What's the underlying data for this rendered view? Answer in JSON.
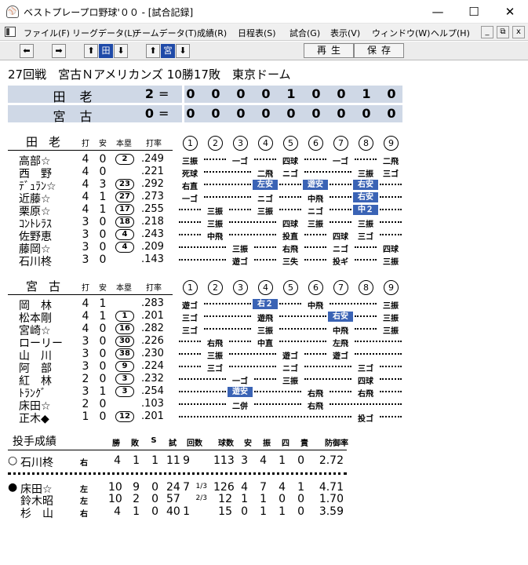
{
  "window": {
    "title": "ベストプレープロ野球'００ - [試合記録]",
    "minimize": "—",
    "maximize": "☐",
    "close": "✕",
    "app_icon": "baseball-cap-icon"
  },
  "menu": [
    "ファイル(F)",
    "リーグデータ(L)",
    "チームデータ(T)",
    "成績(R)",
    "日程表(S)",
    "試合(G)",
    "表示(V)",
    "ウィンドウ(W)",
    "ヘルプ(H)"
  ],
  "mdi": {
    "min": "_",
    "restore": "⧉",
    "close": "x"
  },
  "toolbar": {
    "prev": "⬅",
    "next": "➡",
    "up1": "⬆",
    "team1": "田",
    "down1": "⬇",
    "up2": "⬆",
    "team2": "宮",
    "down2": "⬇",
    "play": "再生",
    "save": "保存"
  },
  "game": {
    "title": "27回戦　宮古Ｎアメリカンズ 10勝17敗　東京ドーム"
  },
  "scoreboard": [
    {
      "team": "田老",
      "total": "2",
      "eq": "=",
      "innings": [
        "0",
        "0",
        "0",
        "0",
        "1",
        "0",
        "0",
        "1",
        "0"
      ]
    },
    {
      "team": "宮古",
      "total": "0",
      "eq": "=",
      "innings": [
        "0",
        "0",
        "0",
        "0",
        "0",
        "0",
        "0",
        "0",
        "0"
      ]
    }
  ],
  "columns": {
    "ab": "打",
    "hit": "安",
    "hr": "本塁",
    "avg": "打率",
    "innings": [
      "1",
      "2",
      "3",
      "4",
      "5",
      "6",
      "7",
      "8",
      "9"
    ]
  },
  "batting": [
    {
      "team": "田老",
      "players": [
        {
          "name": "高部☆",
          "ab": "4",
          "h": "0",
          "hr": "2",
          "avg": ".249",
          "res": {
            "1": "三振",
            "3": "一ゴ",
            "5": "四球",
            "7": "一ゴ",
            "9": "二飛"
          }
        },
        {
          "name": "西　野",
          "ab": "4",
          "h": "0",
          "hr": "",
          "avg": ".221",
          "res": {
            "1": "死球",
            "4": "二飛",
            "5": "ニゴ",
            "8": "三振",
            "9": "三ゴ"
          }
        },
        {
          "name": "ﾃﾞｭﾗﾝ☆",
          "ab": "4",
          "h": "3",
          "hr": "23",
          "avg": ".292",
          "res": {
            "1": "右直",
            "4": "左安",
            "6": "遊安",
            "8": "右安"
          },
          "hl": [
            "4",
            "6",
            "8"
          ]
        },
        {
          "name": "近藤☆",
          "ab": "4",
          "h": "1",
          "hr": "27",
          "avg": ".273",
          "res": {
            "1": "一ゴ",
            "4": "ニゴ",
            "6": "中飛",
            "8": "右安"
          },
          "hl": [
            "8"
          ]
        },
        {
          "name": "栗原☆",
          "ab": "4",
          "h": "1",
          "hr": "17",
          "avg": ".255",
          "res": {
            "2": "三振",
            "4": "三振",
            "6": "ニゴ",
            "8": "中２"
          },
          "hl": [
            "8"
          ]
        },
        {
          "name": "ｺﾝﾄﾚﾗｽ",
          "ab": "3",
          "h": "0",
          "hr": "18",
          "avg": ".218",
          "res": {
            "2": "三振",
            "5": "四球",
            "6": "三振",
            "8": "三振"
          }
        },
        {
          "name": "佐野恵",
          "ab": "3",
          "h": "0",
          "hr": "4",
          "avg": ".243",
          "res": {
            "2": "中飛",
            "5": "投直",
            "7": "四球",
            "8": "三ゴ"
          }
        },
        {
          "name": "藤岡☆",
          "ab": "3",
          "h": "0",
          "hr": "4",
          "avg": ".209",
          "res": {
            "3": "三振",
            "5": "右飛",
            "7": "ニゴ",
            "9": "四球"
          }
        },
        {
          "name": "石川柊",
          "ab": "3",
          "h": "0",
          "hr": "",
          "avg": ".143",
          "res": {
            "3": "遊ゴ",
            "5": "三失",
            "7": "投ギ",
            "9": "三振"
          }
        }
      ]
    },
    {
      "team": "宮古",
      "players": [
        {
          "name": "岡　林",
          "ab": "4",
          "h": "1",
          "hr": "",
          "avg": ".283",
          "res": {
            "1": "遊ゴ",
            "4": "右２",
            "6": "中飛",
            "9": "三振"
          },
          "hl": [
            "4"
          ]
        },
        {
          "name": "松本剛",
          "ab": "4",
          "h": "1",
          "hr": "1",
          "avg": ".201",
          "res": {
            "1": "三ゴ",
            "4": "遊飛",
            "7": "右安",
            "9": "三振"
          },
          "hl": [
            "7"
          ]
        },
        {
          "name": "宮崎☆",
          "ab": "4",
          "h": "0",
          "hr": "16",
          "avg": ".282",
          "res": {
            "1": "三ゴ",
            "4": "三振",
            "7": "中飛",
            "9": "三振"
          }
        },
        {
          "name": "ローリー",
          "ab": "3",
          "h": "0",
          "hr": "30",
          "avg": ".226",
          "res": {
            "2": "右飛",
            "4": "中直",
            "7": "左飛"
          }
        },
        {
          "name": "山　川",
          "ab": "3",
          "h": "0",
          "hr": "38",
          "avg": ".230",
          "res": {
            "2": "三振",
            "5": "遊ゴ",
            "7": "遊ゴ"
          }
        },
        {
          "name": "阿　部",
          "ab": "3",
          "h": "0",
          "hr": "9",
          "avg": ".224",
          "res": {
            "2": "三ゴ",
            "5": "ニゴ",
            "8": "三ゴ"
          }
        },
        {
          "name": "紅　林",
          "ab": "2",
          "h": "0",
          "hr": "3",
          "avg": ".232",
          "res": {
            "3": "一ゴ",
            "5": "三振",
            "8": "四球"
          }
        },
        {
          "name": "ﾄﾗﾝｸﾞ",
          "ab": "3",
          "h": "1",
          "hr": "3",
          "avg": ".254",
          "res": {
            "3": "遊安",
            "6": "右飛",
            "8": "右飛"
          },
          "hl": [
            "3"
          ]
        },
        {
          "name": "床田☆",
          "ab": "2",
          "h": "0",
          "hr": "",
          "avg": ".103",
          "res": {
            "3": "二併",
            "6": "右飛"
          }
        },
        {
          "name": "正木◆",
          "ab": "1",
          "h": "0",
          "hr": "12",
          "avg": ".201",
          "res": {
            "8": "投ゴ"
          }
        }
      ]
    }
  ],
  "pitching": {
    "title": "投手成績",
    "cols": [
      "勝",
      "敗",
      "S",
      "試",
      "回数",
      "球数",
      "安",
      "振",
      "四",
      "責",
      "防御率"
    ],
    "rows": [
      {
        "mark": "○",
        "name": "石川柊",
        "hand": "右",
        "w": "4",
        "l": "1",
        "s": "1",
        "g": "11",
        "ip": "9",
        "frac": "",
        "np": "113",
        "h": "3",
        "k": "4",
        "bb": "1",
        "er": "0",
        "era": "2.72"
      },
      {
        "mark": "●",
        "name": "床田☆",
        "hand": "左",
        "w": "10",
        "l": "9",
        "s": "0",
        "g": "24",
        "ip": "7",
        "frac": "1/3",
        "np": "126",
        "h": "4",
        "k": "7",
        "bb": "4",
        "er": "1",
        "era": "4.71"
      },
      {
        "mark": "",
        "name": "鈴木昭",
        "hand": "左",
        "w": "10",
        "l": "2",
        "s": "0",
        "g": "57",
        "ip": "",
        "frac": "2/3",
        "np": "12",
        "h": "1",
        "k": "1",
        "bb": "0",
        "er": "0",
        "era": "1.70"
      },
      {
        "mark": "",
        "name": "杉　山",
        "hand": "右",
        "w": "4",
        "l": "1",
        "s": "0",
        "g": "40",
        "ip": "1",
        "frac": "",
        "np": "15",
        "h": "0",
        "k": "1",
        "bb": "1",
        "er": "0",
        "era": "3.59"
      }
    ]
  }
}
